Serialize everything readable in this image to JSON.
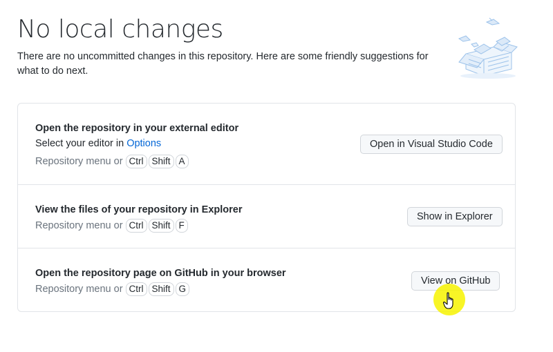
{
  "header": {
    "title": "No local changes",
    "description": "There are no uncommitted changes in this repository. Here are some friendly suggestions for what to do next."
  },
  "illustration": {
    "icon": "open-box-illustration",
    "color": "#b3d1f2"
  },
  "suggestions": [
    {
      "title": "Open the repository in your external editor",
      "subtitle_prefix": "Select your editor in ",
      "subtitle_link": "Options",
      "shortcut_prefix": "Repository menu or",
      "keys": [
        "Ctrl",
        "Shift",
        "A"
      ],
      "button_label": "Open in Visual Studio Code"
    },
    {
      "title": "View the files of your repository in Explorer",
      "shortcut_prefix": "Repository menu or",
      "keys": [
        "Ctrl",
        "Shift",
        "F"
      ],
      "button_label": "Show in Explorer"
    },
    {
      "title": "Open the repository page on GitHub in your browser",
      "shortcut_prefix": "Repository menu or",
      "keys": [
        "Ctrl",
        "Shift",
        "G"
      ],
      "button_label": "View on GitHub"
    }
  ],
  "cursor": {
    "icon": "hand-pointer-icon",
    "highlight_color": "#f7f300"
  }
}
